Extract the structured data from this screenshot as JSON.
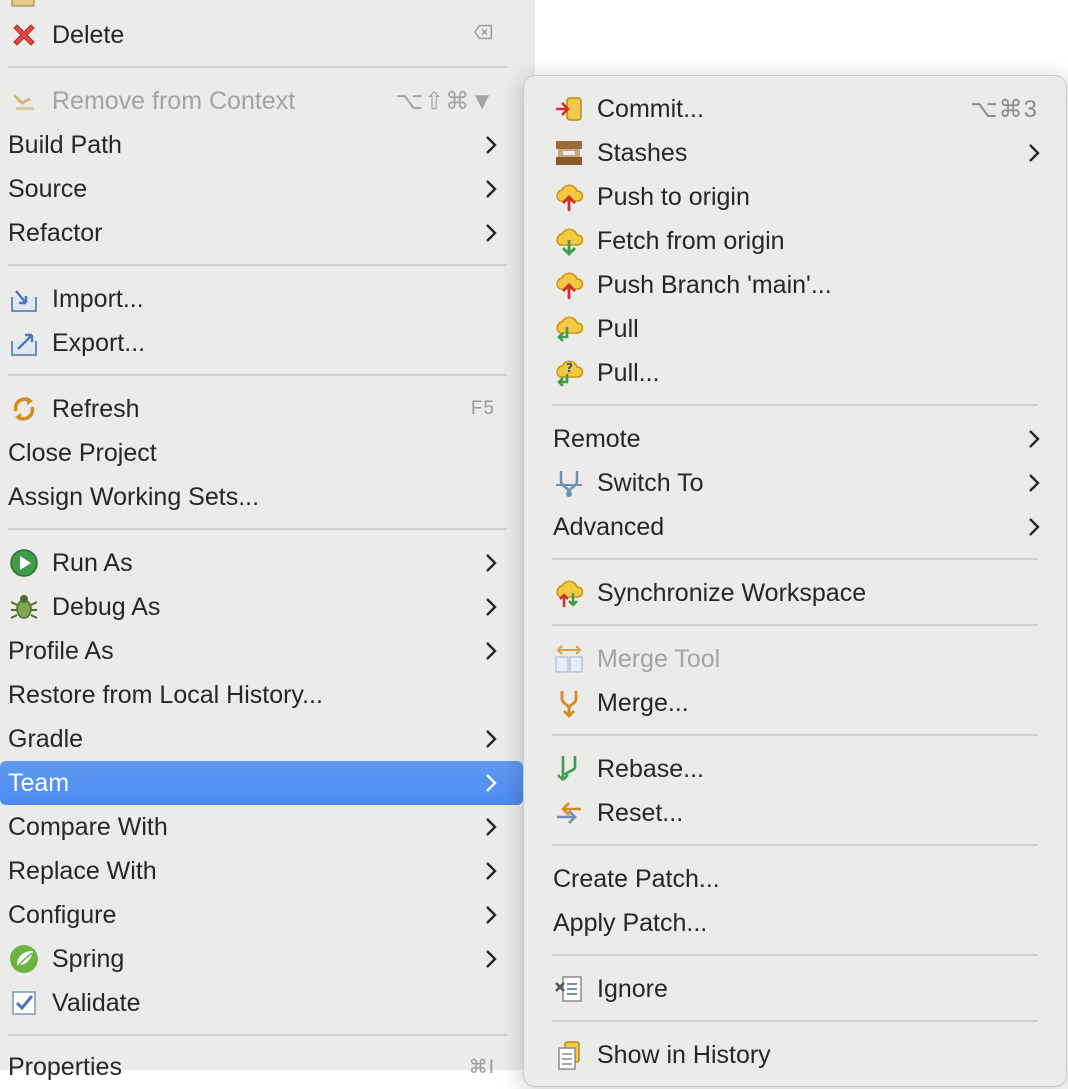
{
  "main_menu": {
    "delete": {
      "label": "Delete"
    },
    "remove_from_context": {
      "label": "Remove from Context",
      "shortcut": "⌥⇧⌘▼"
    },
    "build_path": {
      "label": "Build Path"
    },
    "source": {
      "label": "Source"
    },
    "refactor": {
      "label": "Refactor"
    },
    "import": {
      "label": "Import..."
    },
    "export": {
      "label": "Export..."
    },
    "refresh": {
      "label": "Refresh",
      "shortcut": "F5"
    },
    "close_project": {
      "label": "Close Project"
    },
    "assign_working_sets": {
      "label": "Assign Working Sets..."
    },
    "run_as": {
      "label": "Run As"
    },
    "debug_as": {
      "label": "Debug As"
    },
    "profile_as": {
      "label": "Profile As"
    },
    "restore_history": {
      "label": "Restore from Local History..."
    },
    "gradle": {
      "label": "Gradle"
    },
    "team": {
      "label": "Team"
    },
    "compare_with": {
      "label": "Compare With"
    },
    "replace_with": {
      "label": "Replace With"
    },
    "configure": {
      "label": "Configure"
    },
    "spring": {
      "label": "Spring"
    },
    "validate": {
      "label": "Validate"
    },
    "properties": {
      "label": "Properties",
      "shortcut": "⌘I"
    }
  },
  "team_submenu": {
    "commit": {
      "label": "Commit...",
      "shortcut": "⌥⌘3"
    },
    "stashes": {
      "label": "Stashes"
    },
    "push_origin": {
      "label": "Push to origin"
    },
    "fetch_origin": {
      "label": "Fetch from origin"
    },
    "push_branch": {
      "label": "Push Branch 'main'..."
    },
    "pull": {
      "label": "Pull"
    },
    "pull_dialog": {
      "label": "Pull..."
    },
    "remote": {
      "label": "Remote"
    },
    "switch_to": {
      "label": "Switch To"
    },
    "advanced": {
      "label": "Advanced"
    },
    "synchronize": {
      "label": "Synchronize Workspace"
    },
    "merge_tool": {
      "label": "Merge Tool"
    },
    "merge": {
      "label": "Merge..."
    },
    "rebase": {
      "label": "Rebase..."
    },
    "reset": {
      "label": "Reset..."
    },
    "create_patch": {
      "label": "Create Patch..."
    },
    "apply_patch": {
      "label": "Apply Patch..."
    },
    "ignore": {
      "label": "Ignore"
    },
    "show_history": {
      "label": "Show in History"
    }
  },
  "colors": {
    "selection": "#4c8af0",
    "menu_bg": "#ebebea",
    "disabled_text": "#a3a3a3"
  }
}
